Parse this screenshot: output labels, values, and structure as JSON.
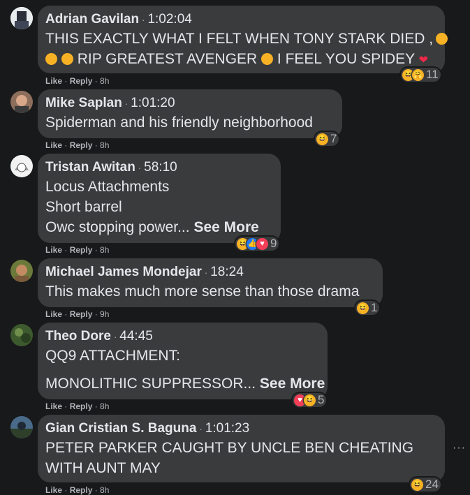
{
  "actions": {
    "like": "Like",
    "reply": "Reply",
    "sep": "·"
  },
  "comments": [
    {
      "author": "Adrian Gavilan",
      "timestamp": "1:02:04",
      "lines": [
        "THIS EXACTLY WHAT I FELT WHEN TONY STARK DIED ,",
        "RIP GREATEST AVENGER",
        "I FEEL YOU SPIDEY"
      ],
      "age": "8h",
      "reactions": [
        "haha",
        "care"
      ],
      "reaction_count": "11"
    },
    {
      "author": "Mike Saplan",
      "timestamp": "1:01:20",
      "lines": [
        "Spiderman and his friendly neighborhood"
      ],
      "age": "8h",
      "reactions": [
        "haha"
      ],
      "reaction_count": "7"
    },
    {
      "author": "Tristan Awitan",
      "timestamp": "58:10",
      "lines": [
        "Locus Attachments",
        "Short barrel",
        "Owc stopping power..."
      ],
      "see_more": "See More",
      "age": "8h",
      "reactions": [
        "haha",
        "like",
        "love"
      ],
      "reaction_count": "9"
    },
    {
      "author": "Michael James Mondejar",
      "timestamp": "18:24",
      "lines": [
        "This makes much more sense than those drama"
      ],
      "age": "9h",
      "reactions": [
        "haha"
      ],
      "reaction_count": "1"
    },
    {
      "author": "Theo Dore",
      "timestamp": "44:45",
      "lines": [
        "QQ9 ATTACHMENT:",
        "MONOLITHIC SUPPRESSOR..."
      ],
      "see_more": "See More",
      "age": "8h",
      "reactions": [
        "love",
        "haha"
      ],
      "reaction_count": "5"
    },
    {
      "author": "Gian Cristian S. Baguna",
      "timestamp": "1:01:23",
      "lines": [
        "PETER PARKER CAUGHT BY UNCLE BEN CHEATING",
        "WITH AUNT MAY"
      ],
      "age": "8h",
      "reactions": [
        "haha"
      ],
      "reaction_count": "24"
    }
  ],
  "more_label": "···"
}
